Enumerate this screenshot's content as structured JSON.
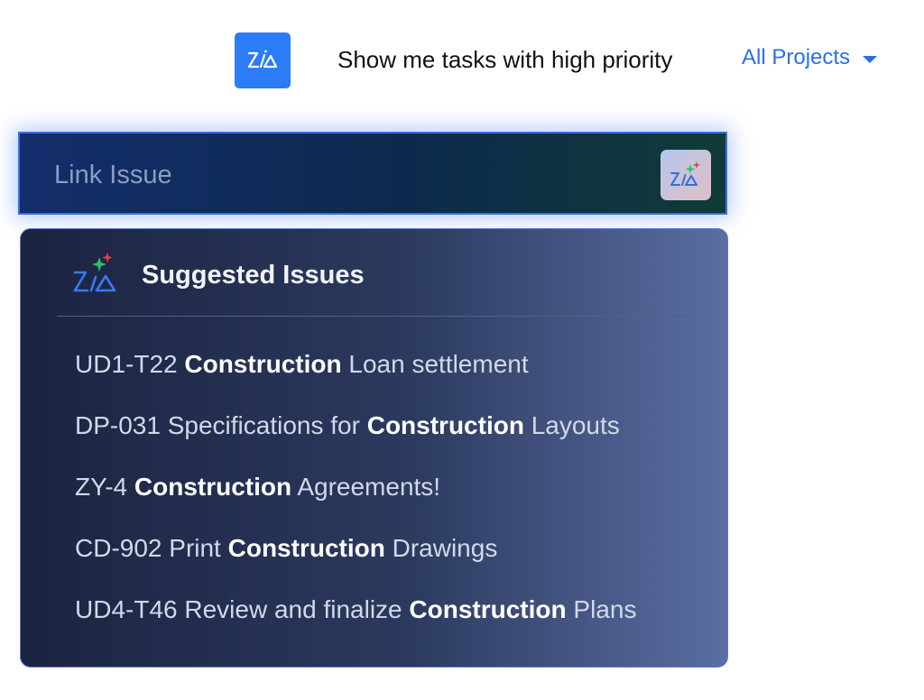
{
  "query": {
    "text": "Show me tasks with high priority",
    "projects_label": "All Projects"
  },
  "link_issue": {
    "placeholder": "Link Issue"
  },
  "suggestions": {
    "title": "Suggested Issues",
    "items": [
      {
        "id": "UD1-T22",
        "before": "",
        "keyword": "Construction",
        "after": "Loan settlement"
      },
      {
        "id": "DP-031",
        "before": "Specifications for",
        "keyword": "Construction",
        "after": "Layouts"
      },
      {
        "id": "ZY-4",
        "before": "",
        "keyword": "Construction",
        "after": "Agreements!"
      },
      {
        "id": "CD-902",
        "before": "Print",
        "keyword": "Construction",
        "after": "Drawings"
      },
      {
        "id": "UD4-T46",
        "before": "Review and finalize",
        "keyword": "Construction",
        "after": "Plans"
      }
    ]
  },
  "icons": {
    "zia_button": "zia-logo-icon",
    "projects_caret": "caret-down-icon",
    "zia_badge": "zia-sparkle-icon",
    "panel_logo": "zia-sparkle-icon"
  },
  "colors": {
    "accent_blue": "#2b7cf6",
    "link_blue": "#2b6fe8",
    "sparkle_green": "#2bbf6a",
    "sparkle_red": "#ec3b3b"
  }
}
